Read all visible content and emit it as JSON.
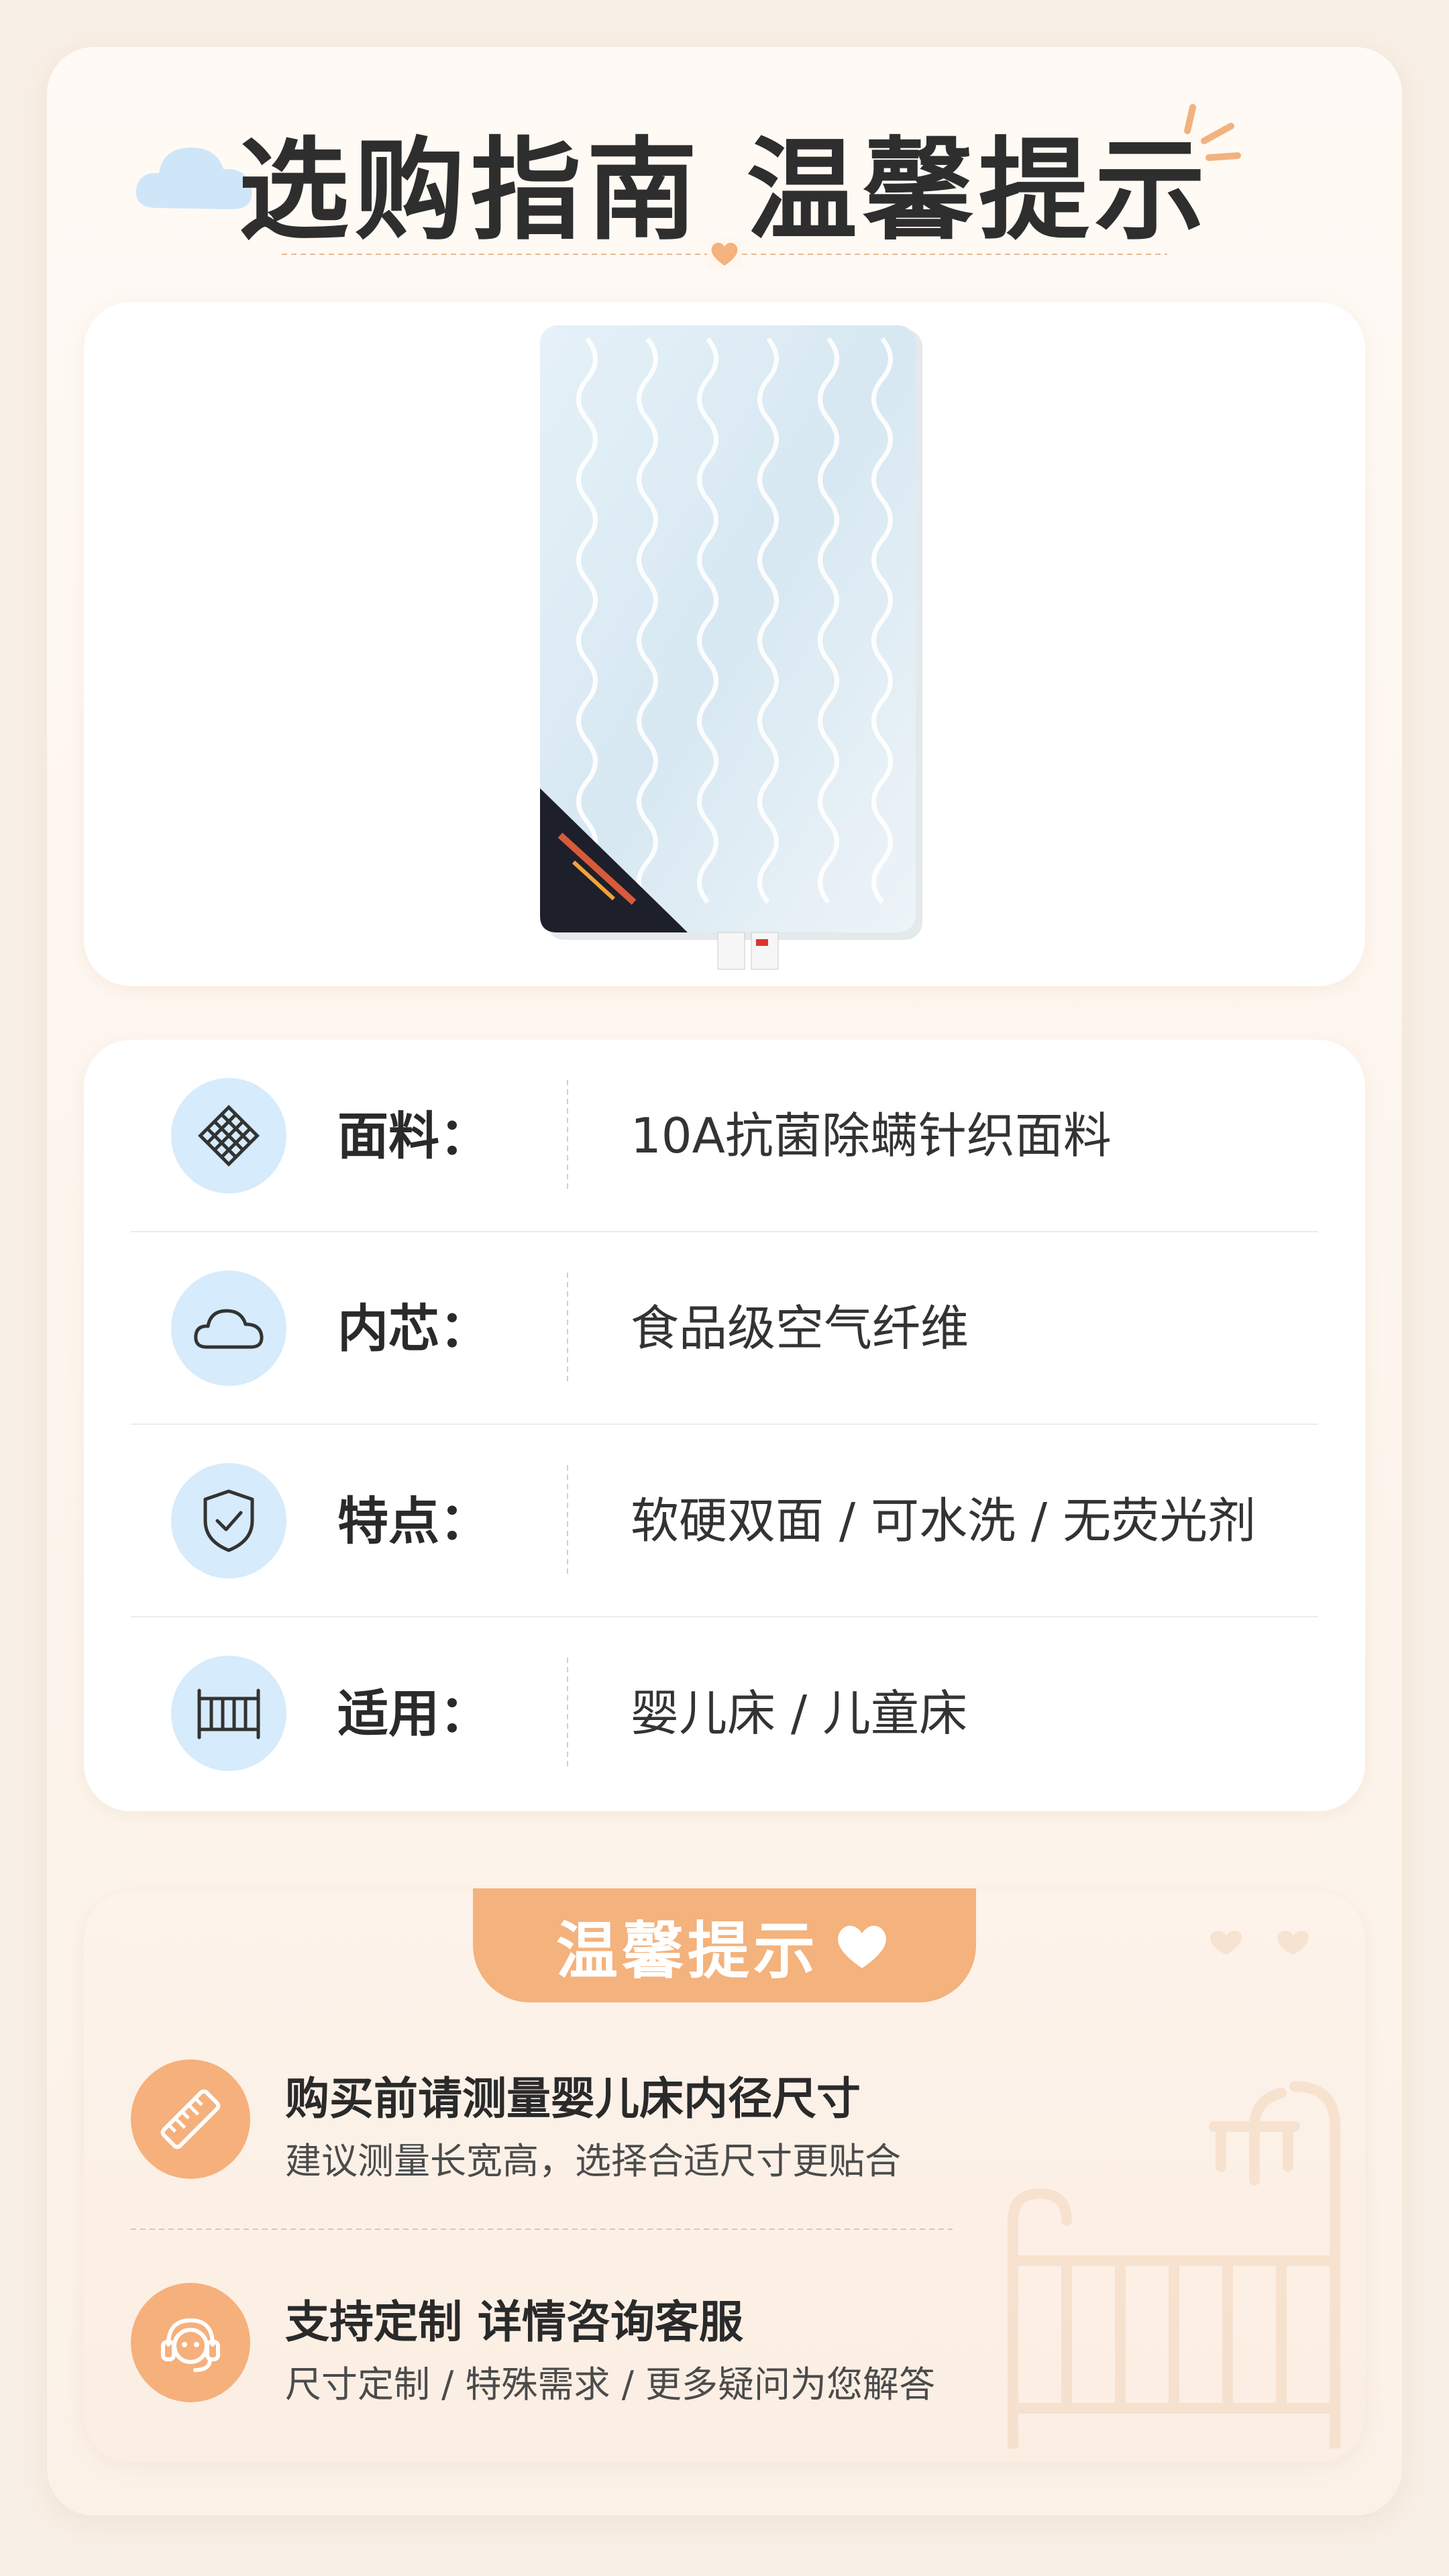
{
  "header": {
    "title": "选购指南 温馨提示"
  },
  "product": {
    "image_icon": "mattress-image"
  },
  "specs": [
    {
      "label": "面料：",
      "value": "10A抗菌除螨针织面料",
      "icon": "fabric-grid-icon"
    },
    {
      "label": "内芯：",
      "value": "食品级空气纤维",
      "icon": "cloud-icon"
    },
    {
      "label": "特点：",
      "value": "软硬双面 / 可水洗 / 无荧光剂",
      "icon": "shield-check-icon"
    },
    {
      "label": "适用：",
      "value": "婴儿床 / 儿童床",
      "icon": "crib-icon"
    }
  ],
  "tips": {
    "tab_label": "温馨提示",
    "items": [
      {
        "title": "购买前请测量婴儿床内径尺寸",
        "subtitle": "建议测量长宽高，选择合适尺寸更贴合",
        "icon": "ruler-icon"
      },
      {
        "title": "支持定制 详情咨询客服",
        "subtitle": "尺寸定制 / 特殊需求 / 更多疑问为您解答",
        "icon": "customer-service-icon"
      }
    ]
  },
  "colors": {
    "accent_orange": "#f4b27c",
    "icon_blue_bg": "#d6ebfb",
    "page_bg": "#f8efe6"
  }
}
